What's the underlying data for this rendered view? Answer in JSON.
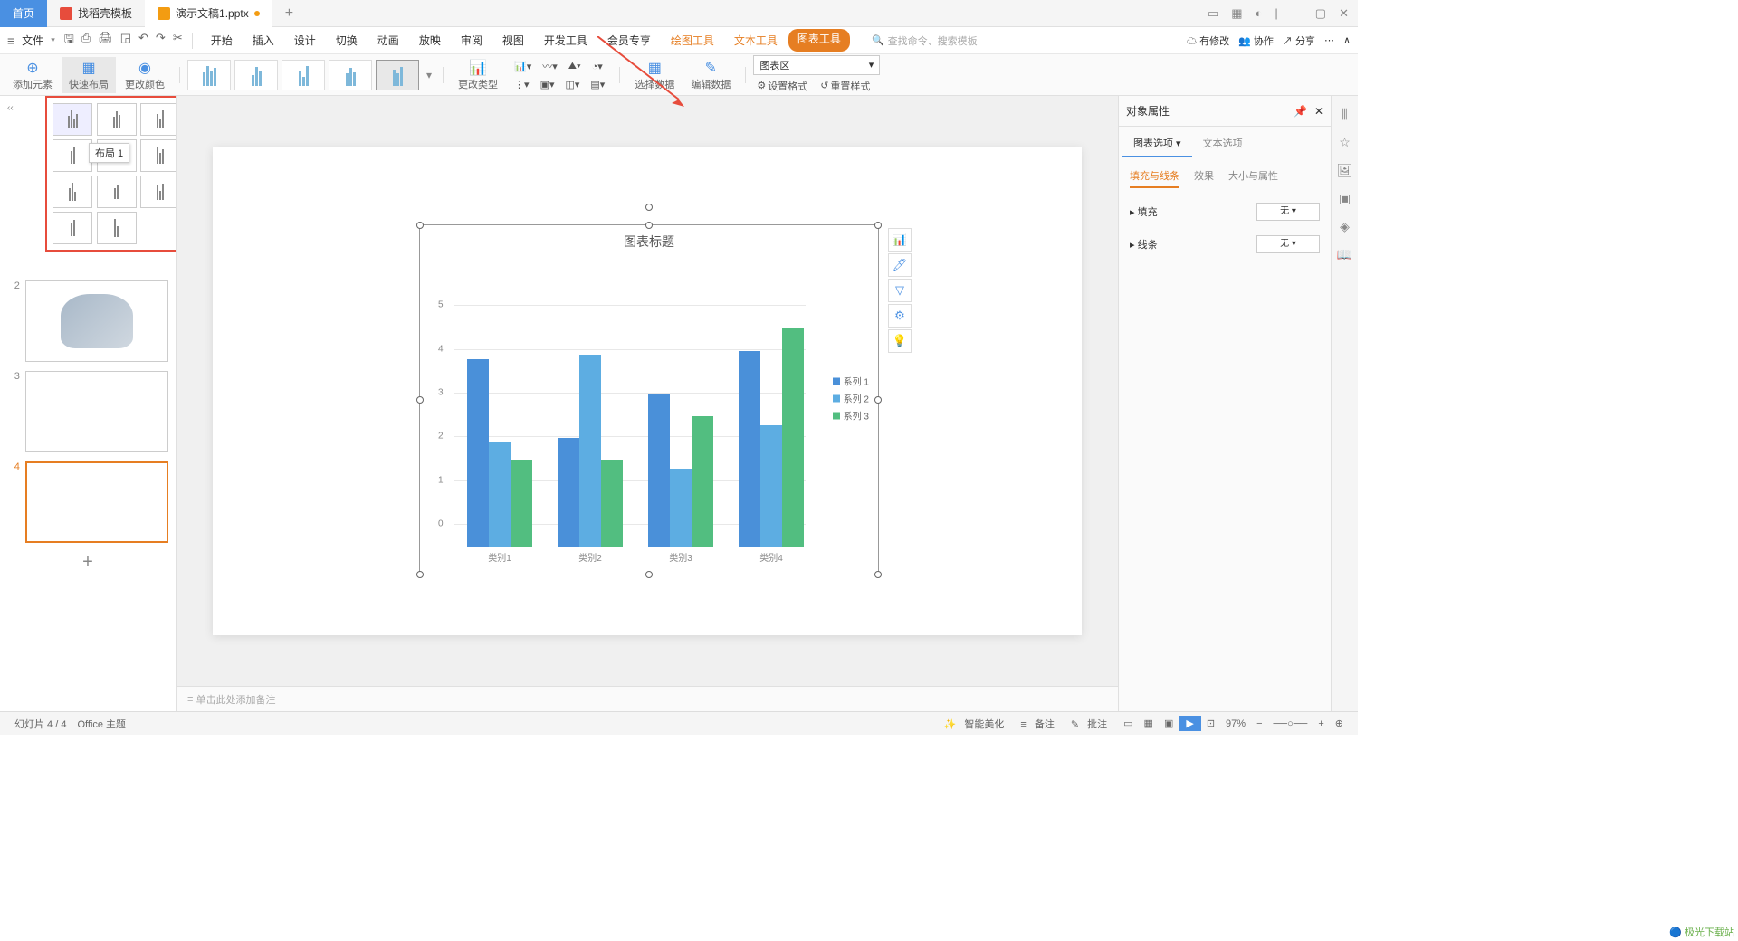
{
  "tabs": {
    "home": "首页",
    "template": "找稻壳模板",
    "doc": "演示文稿1.pptx"
  },
  "menu": {
    "file": "文件",
    "tabs": [
      "开始",
      "插入",
      "设计",
      "切换",
      "动画",
      "放映",
      "审阅",
      "视图",
      "开发工具",
      "会员专享"
    ],
    "tool_tabs": [
      "绘图工具",
      "文本工具",
      "图表工具"
    ],
    "search": "查找命令、搜索模板",
    "changes": "有修改",
    "coop": "协作",
    "share": "分享"
  },
  "ribbon": {
    "add_el": "添加元素",
    "quick_layout": "快速布局",
    "change_color": "更改颜色",
    "change_type": "更改类型",
    "select_data": "选择数据",
    "edit_data": "编辑数据",
    "chart_area": "图表区",
    "set_format": "设置格式",
    "reset_style": "重置样式"
  },
  "layout": {
    "tooltip": "布局 1"
  },
  "chart_data": {
    "type": "bar",
    "title": "图表标题",
    "categories": [
      "类别1",
      "类别2",
      "类别3",
      "类别4"
    ],
    "series": [
      {
        "name": "系列 1",
        "values": [
          4.3,
          2.5,
          3.5,
          4.5
        ],
        "color": "#4a90d9"
      },
      {
        "name": "系列 2",
        "values": [
          2.4,
          4.4,
          1.8,
          2.8
        ],
        "color": "#5dade2"
      },
      {
        "name": "系列 3",
        "values": [
          2.0,
          2.0,
          3.0,
          5.0
        ],
        "color": "#52be80"
      }
    ],
    "ylim": [
      0,
      6
    ],
    "yticks": [
      0,
      1,
      2,
      3,
      4,
      5
    ]
  },
  "props": {
    "title": "对象属性",
    "tab1": "图表选项",
    "tab2": "文本选项",
    "sub1": "填充与线条",
    "sub2": "效果",
    "sub3": "大小与属性",
    "fill": "填充",
    "line": "线条",
    "none": "无"
  },
  "notes": "单击此处添加备注",
  "status": {
    "slide": "幻灯片 4 / 4",
    "theme": "Office 主题",
    "beautify": "智能美化",
    "remark": "备注",
    "comment": "批注",
    "zoom": "97%"
  },
  "watermark": "极光下载站"
}
